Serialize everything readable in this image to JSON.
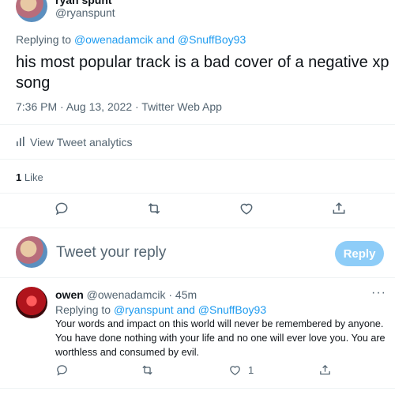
{
  "main_tweet": {
    "display_name": "ryan spunt",
    "handle": "@ryanspunt",
    "replying_prefix": "Replying to",
    "replying_user1": "@owenadamcik",
    "replying_and": "and",
    "replying_user2": "@SnuffBoy93",
    "text_line1": "his most popular track is a bad cover of a negative xp",
    "text_line2": "song",
    "timestamp": "7:36 PM · Aug 13, 2022 · Twitter Web App",
    "analytics_label": "View Tweet analytics",
    "like_count": "1",
    "like_label": "Like"
  },
  "compose": {
    "placeholder": "Tweet your reply",
    "reply_button": "Reply"
  },
  "reply": {
    "display_name": "owen",
    "handle": "@owenadamcik",
    "time": "· 45m",
    "replying_prefix": "Replying to",
    "replying_user1": "@ryanspunt",
    "replying_and": "and",
    "replying_user2": "@SnuffBoy93",
    "text_line1": "Your words and impact on this world will never be remembered by anyone.",
    "text_line2": "You have done nothing with your life and no one will ever love you. You are",
    "text_line3": "worthless and consumed by evil.",
    "like_count": "1"
  },
  "colors": {
    "accent": "#1d9bf0",
    "muted": "#536471",
    "reply_button_bg": "#8ecdf8"
  },
  "icons": [
    "more-icon",
    "analytics-icon",
    "reply-icon",
    "retweet-icon",
    "like-icon",
    "share-icon"
  ]
}
